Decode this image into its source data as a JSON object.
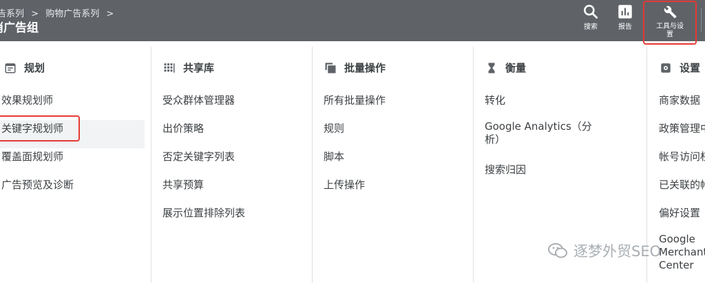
{
  "header": {
    "breadcrumb": [
      "告系列",
      "购物广告系列"
    ],
    "breadcrumb_sep": ">",
    "title": "消广告组",
    "tools": [
      {
        "label": "搜索",
        "icon": "search-icon"
      },
      {
        "label": "报告",
        "icon": "report-icon"
      },
      {
        "label_line1": "工具与设",
        "label_line2": "置",
        "icon": "wrench-icon"
      }
    ]
  },
  "columns": [
    {
      "title": "规划",
      "icon": "calendar-icon",
      "items": [
        "效果规划师",
        "关键字规划师",
        "覆盖面规划师",
        "广告预览及诊断"
      ],
      "active_index": 1
    },
    {
      "title": "共享库",
      "icon": "grid-icon",
      "items": [
        "受众群体管理器",
        "出价策略",
        "否定关键字列表",
        "共享预算",
        "展示位置排除列表"
      ]
    },
    {
      "title": "批量操作",
      "icon": "copy-icon",
      "items": [
        "所有批量操作",
        "规则",
        "脚本",
        "上传操作"
      ]
    },
    {
      "title": "衡量",
      "icon": "hourglass-icon",
      "items": [
        "转化",
        "Google Analytics（分析）",
        "搜索归因"
      ]
    },
    {
      "title": "设置",
      "icon": "gear-icon",
      "items": [
        "商家数据",
        "政策管理中",
        "帐号访问权",
        "已关联的帐",
        "偏好设置",
        "Google Merchant Center"
      ]
    }
  ],
  "watermark": "逐梦外贸SEO",
  "colors": {
    "topbar": "#5f6368",
    "highlight": "#e53935"
  }
}
